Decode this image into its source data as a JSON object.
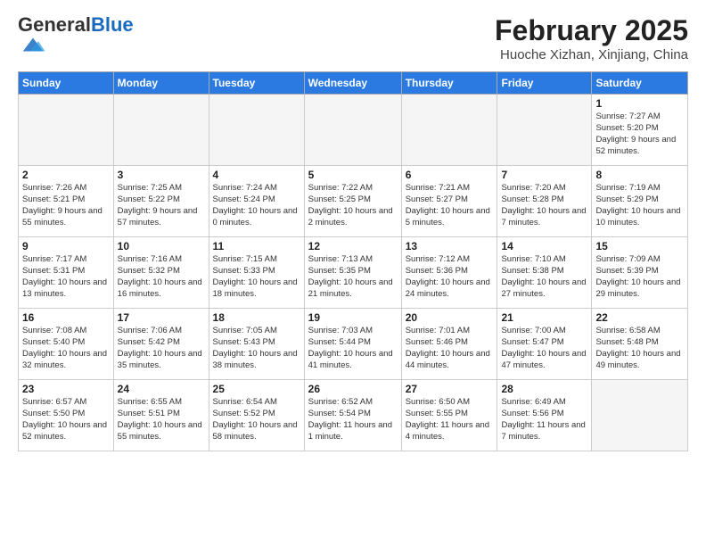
{
  "header": {
    "logo": {
      "general": "General",
      "blue": "Blue"
    },
    "title": "February 2025",
    "subtitle": "Huoche Xizhan, Xinjiang, China"
  },
  "days_of_week": [
    "Sunday",
    "Monday",
    "Tuesday",
    "Wednesday",
    "Thursday",
    "Friday",
    "Saturday"
  ],
  "weeks": [
    [
      {
        "day": "",
        "info": ""
      },
      {
        "day": "",
        "info": ""
      },
      {
        "day": "",
        "info": ""
      },
      {
        "day": "",
        "info": ""
      },
      {
        "day": "",
        "info": ""
      },
      {
        "day": "",
        "info": ""
      },
      {
        "day": "1",
        "info": "Sunrise: 7:27 AM\nSunset: 5:20 PM\nDaylight: 9 hours and 52 minutes."
      }
    ],
    [
      {
        "day": "2",
        "info": "Sunrise: 7:26 AM\nSunset: 5:21 PM\nDaylight: 9 hours and 55 minutes."
      },
      {
        "day": "3",
        "info": "Sunrise: 7:25 AM\nSunset: 5:22 PM\nDaylight: 9 hours and 57 minutes."
      },
      {
        "day": "4",
        "info": "Sunrise: 7:24 AM\nSunset: 5:24 PM\nDaylight: 10 hours and 0 minutes."
      },
      {
        "day": "5",
        "info": "Sunrise: 7:22 AM\nSunset: 5:25 PM\nDaylight: 10 hours and 2 minutes."
      },
      {
        "day": "6",
        "info": "Sunrise: 7:21 AM\nSunset: 5:27 PM\nDaylight: 10 hours and 5 minutes."
      },
      {
        "day": "7",
        "info": "Sunrise: 7:20 AM\nSunset: 5:28 PM\nDaylight: 10 hours and 7 minutes."
      },
      {
        "day": "8",
        "info": "Sunrise: 7:19 AM\nSunset: 5:29 PM\nDaylight: 10 hours and 10 minutes."
      }
    ],
    [
      {
        "day": "9",
        "info": "Sunrise: 7:17 AM\nSunset: 5:31 PM\nDaylight: 10 hours and 13 minutes."
      },
      {
        "day": "10",
        "info": "Sunrise: 7:16 AM\nSunset: 5:32 PM\nDaylight: 10 hours and 16 minutes."
      },
      {
        "day": "11",
        "info": "Sunrise: 7:15 AM\nSunset: 5:33 PM\nDaylight: 10 hours and 18 minutes."
      },
      {
        "day": "12",
        "info": "Sunrise: 7:13 AM\nSunset: 5:35 PM\nDaylight: 10 hours and 21 minutes."
      },
      {
        "day": "13",
        "info": "Sunrise: 7:12 AM\nSunset: 5:36 PM\nDaylight: 10 hours and 24 minutes."
      },
      {
        "day": "14",
        "info": "Sunrise: 7:10 AM\nSunset: 5:38 PM\nDaylight: 10 hours and 27 minutes."
      },
      {
        "day": "15",
        "info": "Sunrise: 7:09 AM\nSunset: 5:39 PM\nDaylight: 10 hours and 29 minutes."
      }
    ],
    [
      {
        "day": "16",
        "info": "Sunrise: 7:08 AM\nSunset: 5:40 PM\nDaylight: 10 hours and 32 minutes."
      },
      {
        "day": "17",
        "info": "Sunrise: 7:06 AM\nSunset: 5:42 PM\nDaylight: 10 hours and 35 minutes."
      },
      {
        "day": "18",
        "info": "Sunrise: 7:05 AM\nSunset: 5:43 PM\nDaylight: 10 hours and 38 minutes."
      },
      {
        "day": "19",
        "info": "Sunrise: 7:03 AM\nSunset: 5:44 PM\nDaylight: 10 hours and 41 minutes."
      },
      {
        "day": "20",
        "info": "Sunrise: 7:01 AM\nSunset: 5:46 PM\nDaylight: 10 hours and 44 minutes."
      },
      {
        "day": "21",
        "info": "Sunrise: 7:00 AM\nSunset: 5:47 PM\nDaylight: 10 hours and 47 minutes."
      },
      {
        "day": "22",
        "info": "Sunrise: 6:58 AM\nSunset: 5:48 PM\nDaylight: 10 hours and 49 minutes."
      }
    ],
    [
      {
        "day": "23",
        "info": "Sunrise: 6:57 AM\nSunset: 5:50 PM\nDaylight: 10 hours and 52 minutes."
      },
      {
        "day": "24",
        "info": "Sunrise: 6:55 AM\nSunset: 5:51 PM\nDaylight: 10 hours and 55 minutes."
      },
      {
        "day": "25",
        "info": "Sunrise: 6:54 AM\nSunset: 5:52 PM\nDaylight: 10 hours and 58 minutes."
      },
      {
        "day": "26",
        "info": "Sunrise: 6:52 AM\nSunset: 5:54 PM\nDaylight: 11 hours and 1 minute."
      },
      {
        "day": "27",
        "info": "Sunrise: 6:50 AM\nSunset: 5:55 PM\nDaylight: 11 hours and 4 minutes."
      },
      {
        "day": "28",
        "info": "Sunrise: 6:49 AM\nSunset: 5:56 PM\nDaylight: 11 hours and 7 minutes."
      },
      {
        "day": "",
        "info": ""
      }
    ]
  ]
}
